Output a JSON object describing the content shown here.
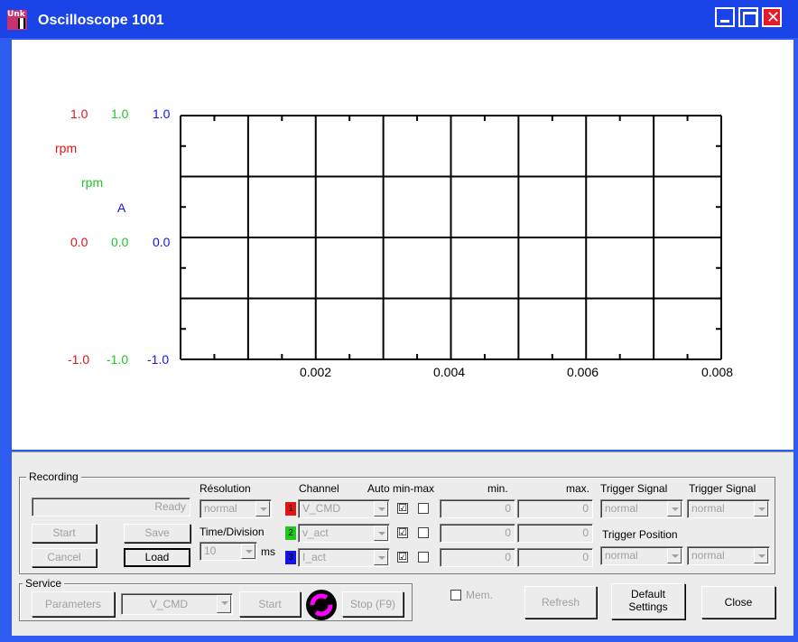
{
  "window": {
    "title": "Oscilloscope 1001",
    "icon_text": "Unk"
  },
  "chart_data": {
    "type": "line",
    "x_ticks": [
      "0.002",
      "0.004",
      "0.006",
      "0.008"
    ],
    "xlim": [
      0,
      0.008
    ],
    "grid": true,
    "y_axes": [
      {
        "color": "#e11414",
        "top": "1.0",
        "mid": "0.0",
        "bottom": "-1.0",
        "unit": "rpm",
        "ylim": [
          -1,
          1
        ]
      },
      {
        "color": "#1ec81e",
        "top": "1.0",
        "mid": "0.0",
        "bottom": "-1.0",
        "unit": "rpm",
        "ylim": [
          -1,
          1
        ]
      },
      {
        "color": "#1414e6",
        "top": "1.0",
        "mid": "0.0",
        "bottom": "-1.0",
        "unit": "A",
        "ylim": [
          -1,
          1
        ]
      }
    ],
    "series": []
  },
  "recording": {
    "title": "Recording",
    "status": "Ready",
    "start": "Start",
    "save": "Save",
    "cancel": "Cancel",
    "load": "Load",
    "resolution_label": "Résolution",
    "resolution_value": "normal",
    "time_div_label": "Time/Division",
    "time_div_value": "10",
    "time_div_unit": "ms",
    "channel_label": "Channel",
    "auto_label": "Auto min-max",
    "min_label": "min.",
    "max_label": "max.",
    "channels": [
      {
        "num": "1",
        "color": "#e11414",
        "name": "V_CMD",
        "auto": "☑",
        "min": "0",
        "max": "0"
      },
      {
        "num": "2",
        "color": "#1ec81e",
        "name": "v_act",
        "auto": "☑",
        "min": "0",
        "max": "0"
      },
      {
        "num": "3",
        "color": "#1414e6",
        "name": "I_act",
        "auto": "☑",
        "min": "0",
        "max": "0"
      }
    ],
    "trigger_signal_label_1": "Trigger Signal",
    "trigger_signal_label_2": "Trigger Signal",
    "trigger_signal_1": "normal",
    "trigger_signal_2": "normal",
    "trigger_position_label": "Trigger Position",
    "trigger_position_1": "normal",
    "trigger_position_2": "normal"
  },
  "service": {
    "title": "Service",
    "parameters": "Parameters",
    "channel_value": "V_CMD",
    "start": "Start",
    "stop": "Stop (F9)"
  },
  "footer": {
    "mem_label": "Mem.",
    "refresh": "Refresh",
    "default_settings_1": "Default",
    "default_settings_2": "Settings",
    "close": "Close"
  }
}
